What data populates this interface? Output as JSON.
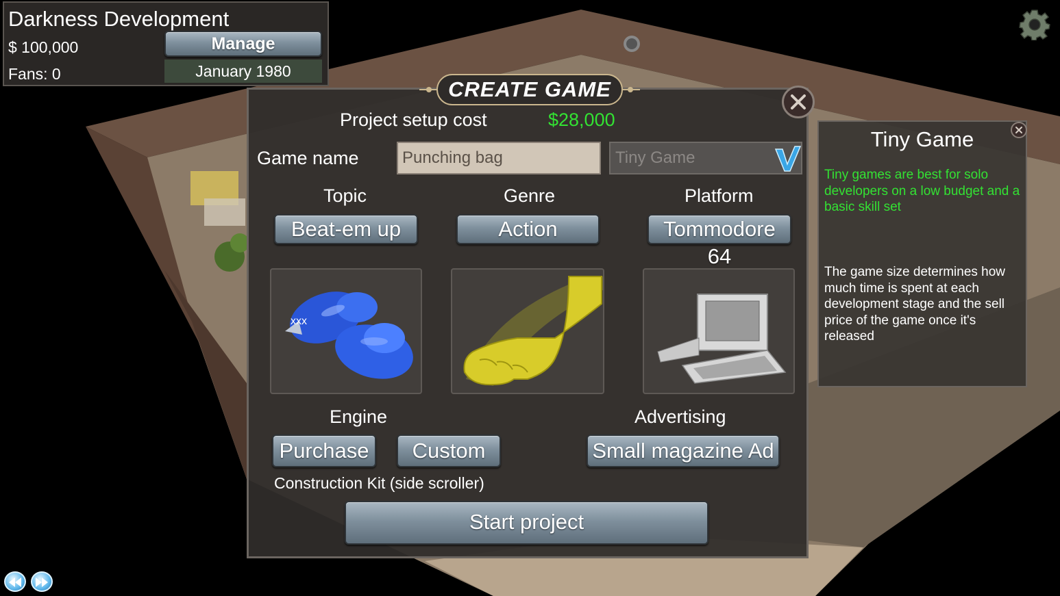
{
  "company": {
    "name": "Darkness Development",
    "money": "$ 100,000",
    "fans": "Fans: 0",
    "manage_label": "Manage",
    "date": "January 1980"
  },
  "dialog": {
    "title": "CREATE GAME",
    "cost_label": "Project setup cost",
    "cost_value": "$28,000",
    "name_label": "Game name",
    "name_value": "Punching bag",
    "size_value": "Tiny Game",
    "topic_label": "Topic",
    "topic_value": "Beat-em up",
    "genre_label": "Genre",
    "genre_value": "Action",
    "platform_label": "Platform",
    "platform_value": "Tommodore 64",
    "engine_label": "Engine",
    "engine_purchase": "Purchase",
    "engine_custom": "Custom",
    "engine_name": "Construction Kit (side scroller)",
    "advertising_label": "Advertising",
    "advertising_value": "Small magazine Ad",
    "start_label": "Start project"
  },
  "info": {
    "title": "Tiny Game",
    "highlight": "Tiny games are best for solo developers on a low budget and a basic skill set",
    "description": "The game size determines how much time is spent at each development stage and the sell price of the game once it's released"
  },
  "icons": {
    "settings": "gear-icon",
    "close": "close-icon",
    "confirm": "checkmark-icon",
    "rewind": "rewind-icon",
    "fast_forward": "fast-forward-icon"
  },
  "colors": {
    "accent_green": "#33e233",
    "button_blue": "#7f909d"
  }
}
